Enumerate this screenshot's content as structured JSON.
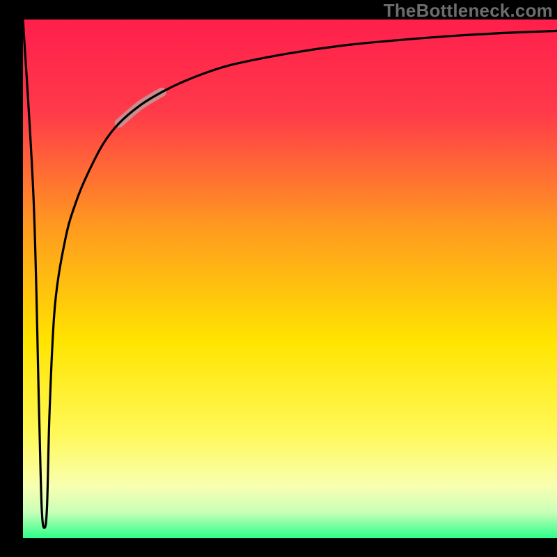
{
  "watermark": "TheBottleneck.com",
  "chart_data": {
    "type": "line",
    "title": "",
    "xlabel": "",
    "ylabel": "",
    "xlim": [
      0,
      100
    ],
    "ylim": [
      0,
      100
    ],
    "grid": false,
    "legend": false,
    "axes_hidden": true,
    "background_gradient": {
      "top": "#ff1f4b",
      "mid_upper": "#ff9a1f",
      "mid": "#ffe400",
      "lower": "#f8ffb0",
      "bottom_band": "#2bff8a"
    },
    "series": [
      {
        "name": "bottleneck-curve",
        "description": "Main black curve: steep plunge near x≈0 toward y≈0, then a sharp rise that asymptotically approaches y≈100 as x→100. The highlighted (thick pale-rose) band covers roughly x∈[18,28].",
        "x": [
          0,
          2,
          3,
          3.5,
          4,
          4.5,
          5,
          6,
          8,
          10,
          12,
          15,
          18,
          22,
          26,
          30,
          35,
          40,
          50,
          60,
          70,
          80,
          90,
          100
        ],
        "y": [
          100,
          65,
          25,
          6,
          2,
          6,
          25,
          45,
          58,
          65,
          70,
          76,
          80,
          83.5,
          86,
          88,
          90,
          91.5,
          93.5,
          95,
          96,
          96.8,
          97.4,
          97.8
        ],
        "highlight_range_x": [
          18,
          28
        ],
        "colors": {
          "line": "#000000",
          "highlight": "#c98d8d"
        }
      }
    ]
  }
}
